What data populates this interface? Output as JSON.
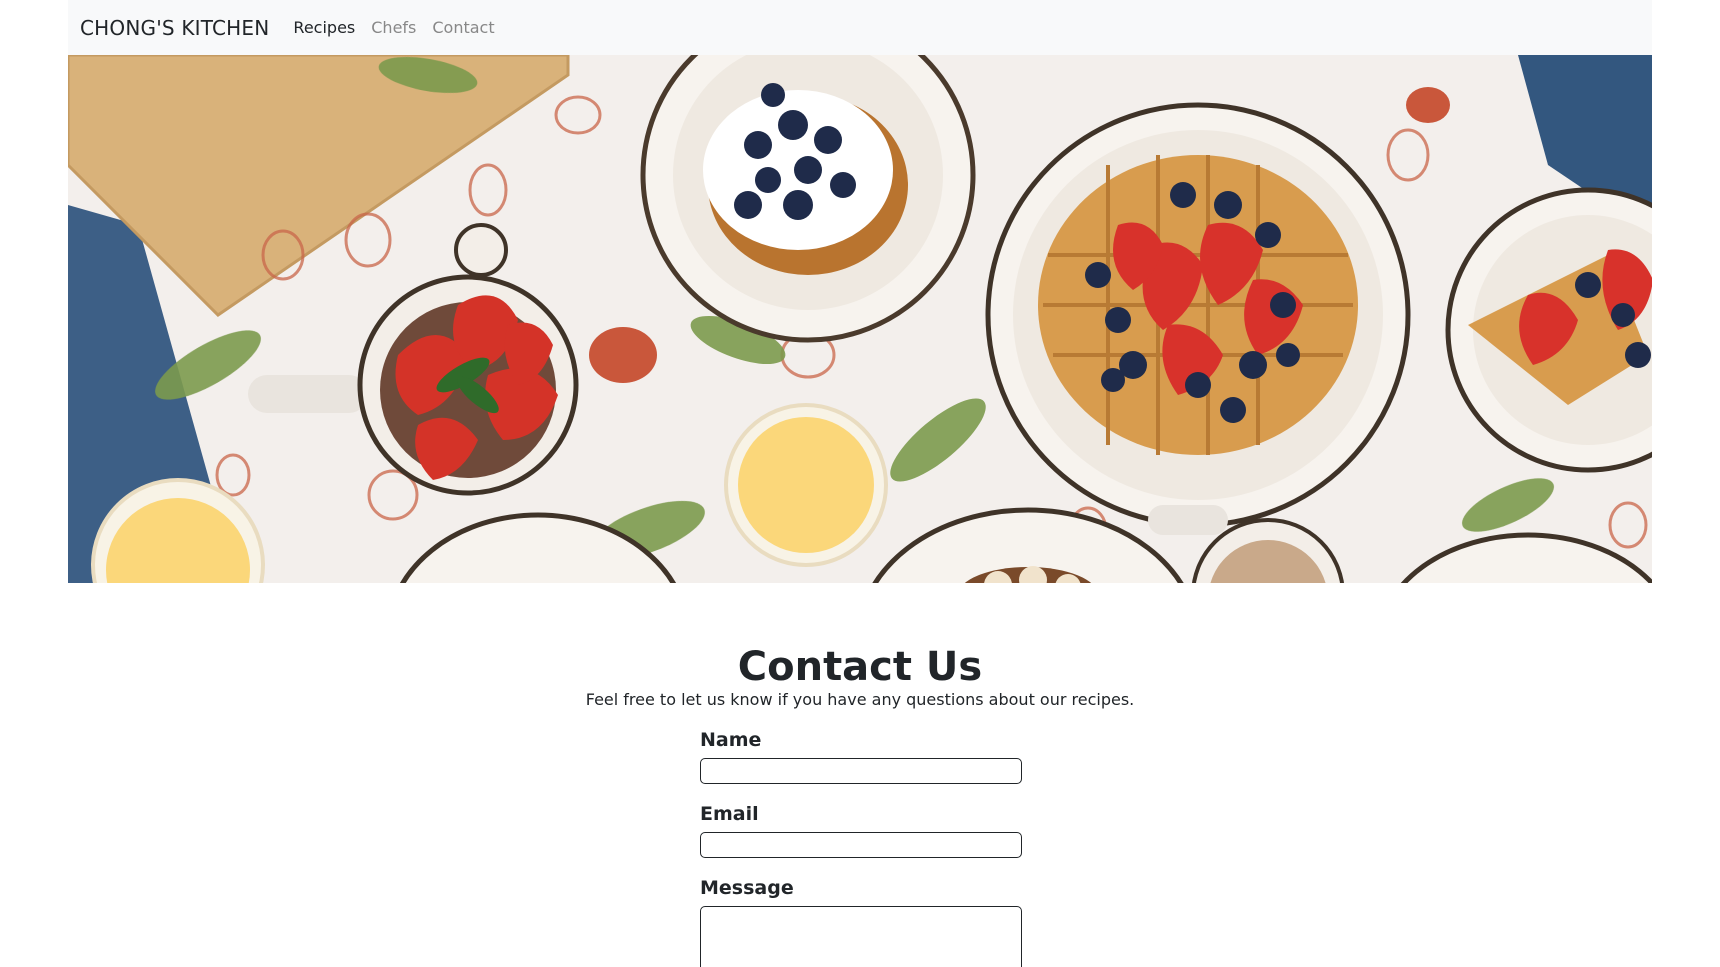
{
  "navbar": {
    "brand": "CHONG'S KITCHEN",
    "links": [
      {
        "label": "Recipes",
        "active": true
      },
      {
        "label": "Chefs",
        "active": false
      },
      {
        "label": "Contact",
        "active": false
      }
    ]
  },
  "main": {
    "title": "Contact Us",
    "subtitle": "Feel free to let us know if you have any questions about our recipes."
  },
  "form": {
    "name_label": "Name",
    "name_value": "",
    "email_label": "Email",
    "email_value": "",
    "message_label": "Message",
    "message_value": ""
  },
  "colors": {
    "navbar_bg": "#f8f9fa",
    "text": "#212529",
    "muted_link": "#888888"
  }
}
